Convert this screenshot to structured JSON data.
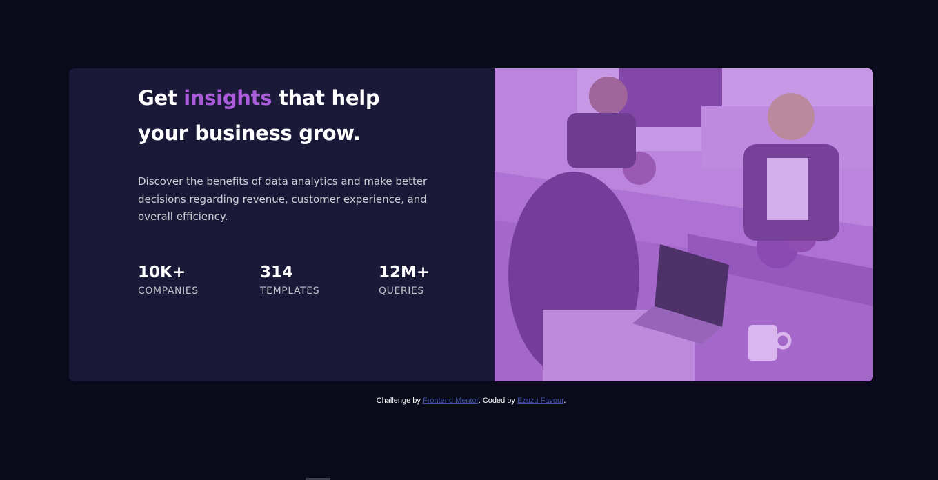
{
  "card": {
    "headline_before": "Get ",
    "headline_accent": "insights",
    "headline_after": " that help your business grow.",
    "description": "Discover the benefits of data analytics and make better decisions regarding revenue, customer experience, and overall efficiency.",
    "stats": [
      {
        "value": "10K+",
        "label": "companies"
      },
      {
        "value": "314",
        "label": "templates"
      },
      {
        "value": "12M+",
        "label": "queries"
      }
    ],
    "image_description": "people working in an office with laptops, purple tinted"
  },
  "attribution": {
    "prefix": "Challenge by ",
    "mentor_link": "Frontend Mentor",
    "middle": ". Coded by ",
    "author_link": "Ezuzu Favour",
    "suffix": "."
  },
  "colors": {
    "page_background": "#090b1a",
    "card_background": "#1b1938",
    "accent": "#ab5cdb",
    "image_overlay": "#aa5cdb",
    "link": "#3e52a3"
  }
}
